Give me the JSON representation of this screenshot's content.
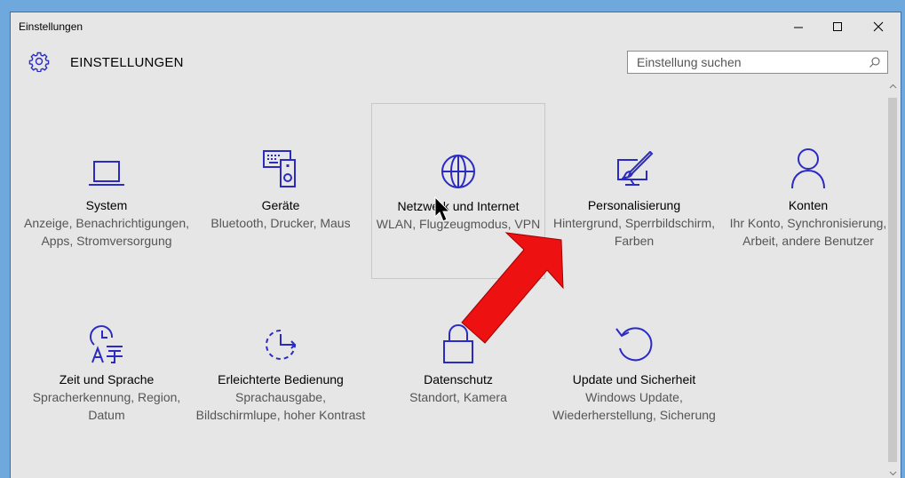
{
  "window": {
    "title": "Einstellungen",
    "controls": [
      "minimize",
      "maximize",
      "close"
    ]
  },
  "header": {
    "title": "EINSTELLUNGEN",
    "icon": "gear-icon"
  },
  "search": {
    "placeholder": "Einstellung suchen",
    "value": ""
  },
  "tiles": [
    {
      "name": "System",
      "desc": "Anzeige, Benachrichtigungen, Apps, Stromversorgung",
      "icon": "laptop-icon"
    },
    {
      "name": "Geräte",
      "desc": "Bluetooth, Drucker, Maus",
      "icon": "devices-icon"
    },
    {
      "name": "Netzwerk und Internet",
      "desc": "WLAN, Flugzeugmodus, VPN",
      "icon": "globe-icon"
    },
    {
      "name": "Personalisierung",
      "desc": "Hintergrund, Sperrbildschirm, Farben",
      "icon": "paint-icon"
    },
    {
      "name": "Konten",
      "desc": "Ihr Konto, Synchronisierung, Arbeit, andere Benutzer",
      "icon": "person-icon"
    },
    {
      "name": "Zeit und Sprache",
      "desc": "Spracherkennung, Region, Datum",
      "icon": "time-language-icon"
    },
    {
      "name": "Erleichterte Bedienung",
      "desc": "Sprachausgabe, Bildschirmlupe, hoher Kontrast",
      "icon": "ease-of-access-icon"
    },
    {
      "name": "Datenschutz",
      "desc": "Standort, Kamera",
      "icon": "lock-icon"
    },
    {
      "name": "Update und Sicherheit",
      "desc": "Windows Update, Wiederherstellung, Sicherung",
      "icon": "update-icon"
    }
  ],
  "colors": {
    "accent": "#2b2bc4",
    "background": "#e6e6e6",
    "annotation_arrow": "#ee1111"
  }
}
